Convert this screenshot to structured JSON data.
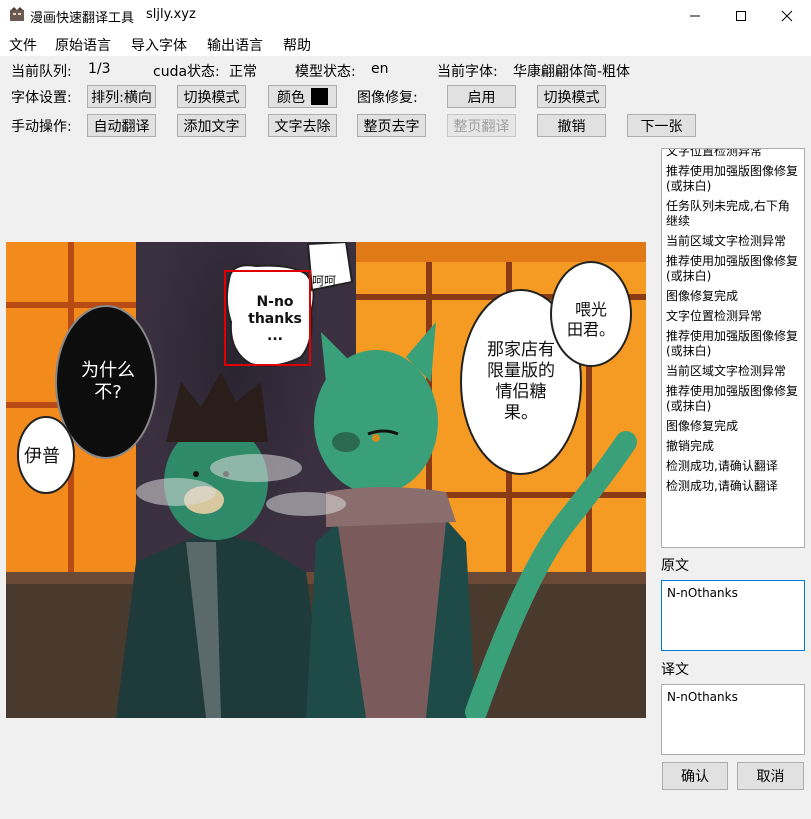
{
  "window": {
    "title": "漫画快速翻译工具",
    "subtitle": "sljly.xyz"
  },
  "menu": [
    "文件",
    "原始语言",
    "导入字体",
    "输出语言",
    "帮助"
  ],
  "status": {
    "queue_label": "当前队列:",
    "queue_value": "1/3",
    "cuda_label": "cuda状态:",
    "cuda_value": "正常",
    "model_label": "模型状态:",
    "model_value": "en",
    "font_label": "当前字体:",
    "font_value": "华康翩翩体简-粗体"
  },
  "font_settings": {
    "label": "字体设置:",
    "layout_button": "排列:横向",
    "switch_mode_button": "切换模式",
    "color_button": "颜色",
    "color_value": "#000000",
    "inpaint_label": "图像修复:",
    "enable_button": "启用",
    "inpaint_switch_mode_button": "切换模式"
  },
  "manual_ops": {
    "label": "手动操作:",
    "auto_translate": "自动翻译",
    "add_text": "添加文字",
    "remove_text": "文字去除",
    "page_remove_text": "整页去字",
    "page_translate": "整页翻译",
    "undo": "撤销",
    "next": "下一张"
  },
  "log": [
    "文字位置检测异常",
    "推荐使用加强版图像修复(或抹白)",
    "任务队列未完成,右下角继续",
    "当前区域文字检测异常",
    "推荐使用加强版图像修复(或抹白)",
    "图像修复完成",
    "文字位置检测异常",
    "推荐使用加强版图像修复(或抹白)",
    "当前区域文字检测异常",
    "推荐使用加强版图像修复(或抹白)",
    "图像修复完成",
    "撤销完成",
    "检测成功,请确认翻译",
    "检测成功,请确认翻译"
  ],
  "original": {
    "label": "原文",
    "text": "N-nOthanks"
  },
  "translation": {
    "label": "译文",
    "text": "N-nOthanks"
  },
  "confirm_button": "确认",
  "cancel_button": "取消",
  "comic": {
    "bubble_center": [
      "N-no",
      "thanks",
      "..."
    ],
    "bubble_small": "呵呵",
    "bubble_left_top": [
      "为什么",
      "不?"
    ],
    "bubble_left_bottom": "伊普",
    "bubble_right_large": [
      "那家店有",
      "限量版的",
      "情侣糖",
      "果。"
    ],
    "bubble_right_top": [
      "喂光",
      "田君。"
    ]
  }
}
